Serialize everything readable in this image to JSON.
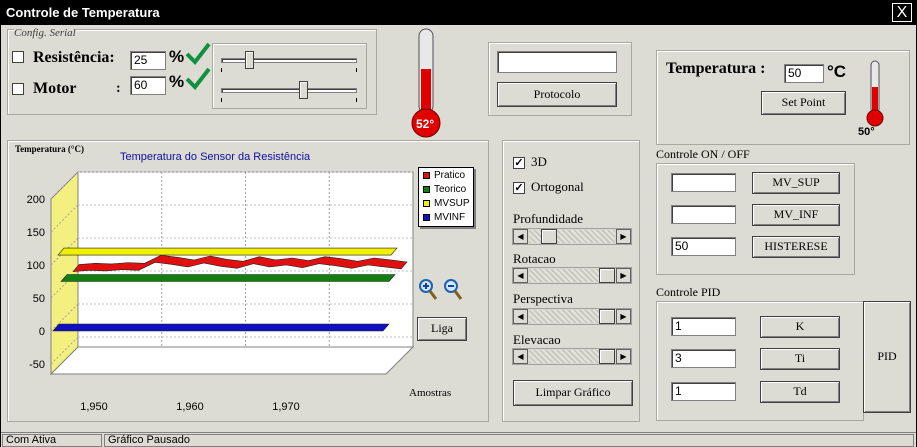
{
  "window": {
    "title": "Controle de Temperatura",
    "close_label": "X"
  },
  "serial": {
    "label": "Config. Serial"
  },
  "resistencia": {
    "label": "Resistência:",
    "value": "25",
    "unit": "%",
    "checked": false,
    "slider_fraction": 0.2
  },
  "motor": {
    "label": "Motor",
    "colon": ":",
    "value": "60",
    "unit": "%",
    "checked": false,
    "slider_fraction": 0.6
  },
  "thermometer_big": {
    "value_label": "52°",
    "level": 0.52
  },
  "protocolo": {
    "input_value": "",
    "button_label": "Protocolo"
  },
  "temperatura": {
    "label": "Temperatura :",
    "value": "50",
    "unit": "°C",
    "button_label": "Set Point",
    "thermo_label": "50°",
    "level": 0.5
  },
  "controle_onoff": {
    "label": "Controle ON / OFF",
    "rows": [
      {
        "value": "",
        "button": "MV_SUP"
      },
      {
        "value": "",
        "button": "MV_INF"
      },
      {
        "value": "50",
        "button": "HISTERESE"
      }
    ]
  },
  "controle_pid": {
    "label": "Controle PID",
    "rows": [
      {
        "value": "1",
        "button": "K"
      },
      {
        "value": "3",
        "button": "Ti"
      },
      {
        "value": "1",
        "button": "Td"
      }
    ],
    "pid_button": "PID"
  },
  "options": {
    "check_3d": {
      "label": "3D",
      "checked": true
    },
    "check_ortogonal": {
      "label": "Ortogonal",
      "checked": true
    },
    "profundidade": "Profundidade",
    "rotacao": "Rotacao",
    "perspectiva": "Perspectiva",
    "elevacao": "Elevacao",
    "limpar_button": "Limpar Gráfico"
  },
  "liga_button": "Liga",
  "zoom_in_icon": "zoom-in-icon",
  "zoom_out_icon": "zoom-out-icon",
  "status": {
    "cell1": "Com Ativa",
    "cell2": "Gráfico Pausado"
  },
  "chart_data": {
    "type": "line",
    "title": "Temperatura do Sensor da Resistência",
    "ylabel": "Temperatura (°C)",
    "xlabel": "Amostras",
    "ylim": [
      -50,
      200
    ],
    "yticks": [
      "200",
      "150",
      "100",
      "50",
      "0",
      "-50"
    ],
    "xticks": [
      "1,950",
      "1,960",
      "1,970"
    ],
    "legend_position": "top-right",
    "series": [
      {
        "name": "Pratico",
        "color": "#e01010",
        "values": [
          90,
          92,
          91,
          93,
          92,
          104,
          101,
          97,
          103,
          98,
          95,
          102,
          97,
          100,
          96,
          102,
          99,
          95,
          100,
          97,
          94
        ]
      },
      {
        "name": "Teorico",
        "color": "#108010",
        "values": [
          75,
          75
        ]
      },
      {
        "name": "MVSUP",
        "color": "#f0f000",
        "values": [
          115,
          115
        ]
      },
      {
        "name": "MVINF",
        "color": "#1010c0",
        "values": [
          0,
          0
        ]
      }
    ]
  }
}
